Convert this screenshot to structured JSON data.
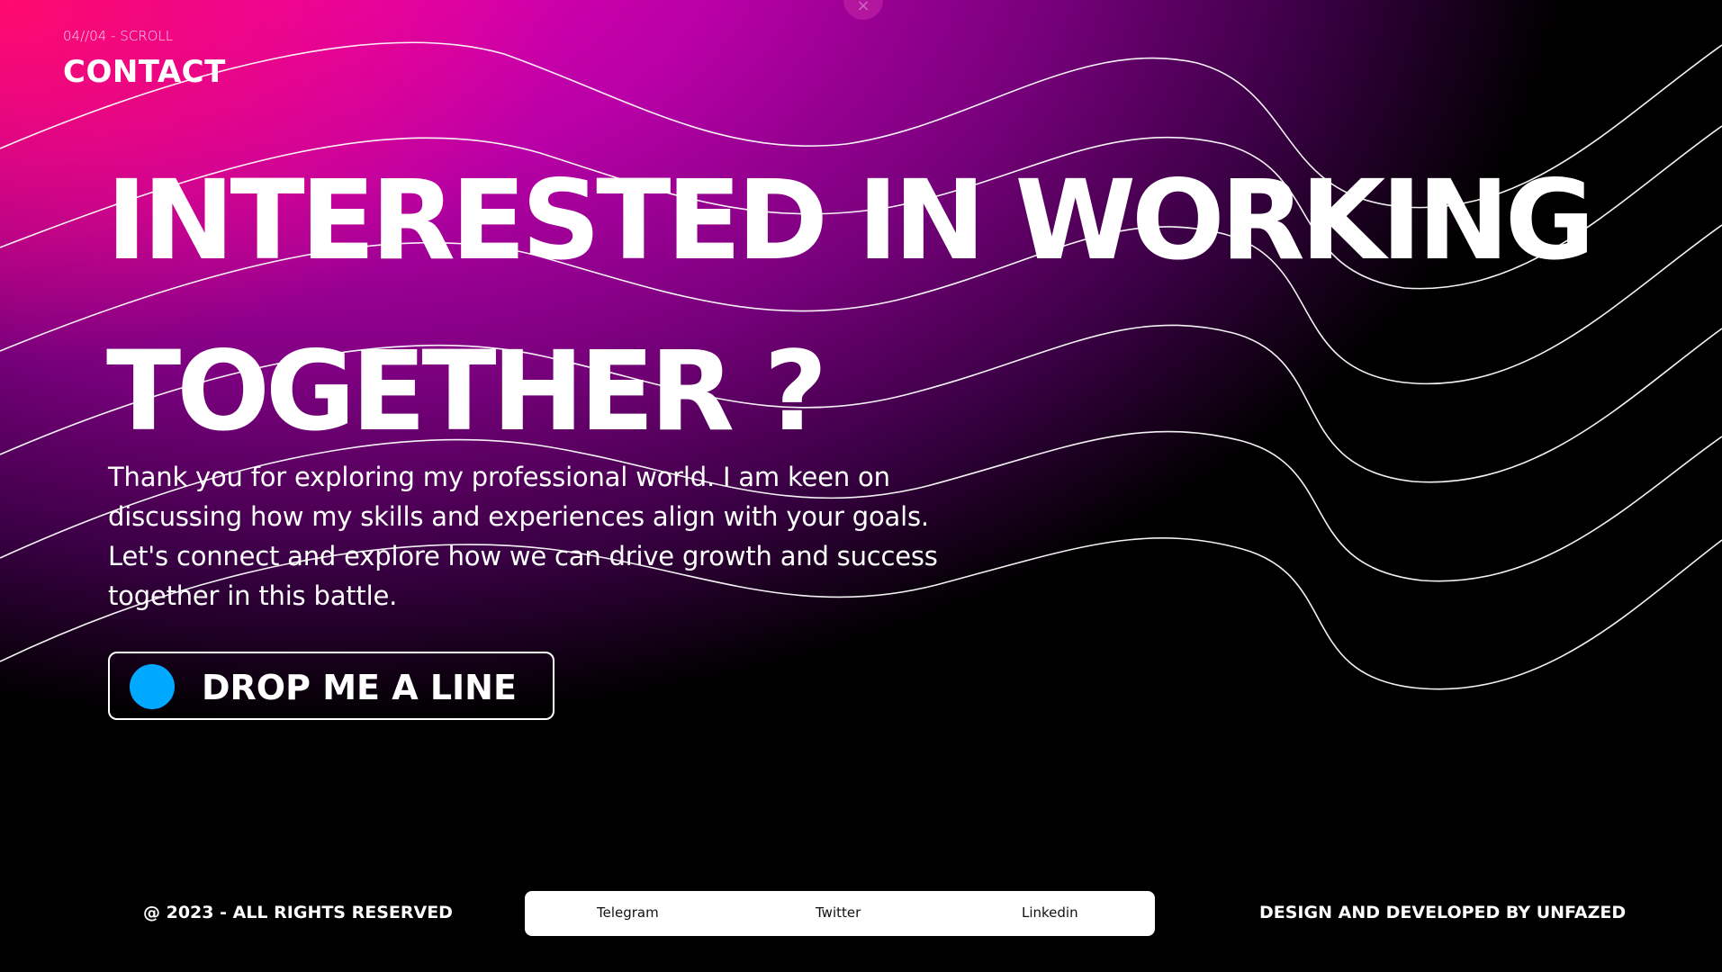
{
  "header": {
    "section_counter": "04//04 - SCROLL",
    "section_title": "CONTACT",
    "close_glyph": "×"
  },
  "hero": {
    "headline_line1": "INTERESTED IN WORKING",
    "headline_line2": "TOGETHER ?",
    "intro_line1": "Thank you for exploring my professional world. I am keen on",
    "intro_line2": "discussing how my skills and experiences align with your goals.",
    "intro_line3": "Let's connect and explore how we can drive growth and success",
    "intro_line4": "together in this battle.",
    "cta_label": "DROP ME A LINE"
  },
  "footer": {
    "copyright": "@ 2023 - ALL RIGHTS RESERVED",
    "credit": "DESIGN AND DEVELOPED BY UNFAZED",
    "social_links": [
      "Telegram",
      "Twitter",
      "Linkedin"
    ]
  },
  "colors": {
    "gradient_hot": "#ff0a6e",
    "gradient_magenta": "#f000b4",
    "gradient_purple": "#7a007e",
    "background": "#000000",
    "cta_dot": "#00a9ff",
    "social_bar": "#ffffff"
  }
}
